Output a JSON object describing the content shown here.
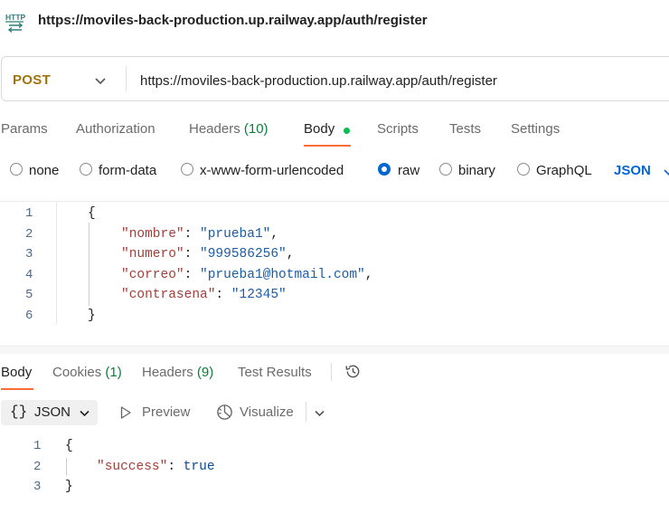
{
  "title_bar": {
    "icon_text": "HTTP",
    "url": "https://moviles-back-production.up.railway.app/auth/register"
  },
  "request": {
    "method": "POST",
    "url": "https://moviles-back-production.up.railway.app/auth/register"
  },
  "request_tabs": {
    "params": "Params",
    "authorization": "Authorization",
    "headers": "Headers",
    "headers_count": "(10)",
    "body": "Body",
    "scripts": "Scripts",
    "tests": "Tests",
    "settings": "Settings"
  },
  "body_types": {
    "none": "none",
    "form_data": "form-data",
    "urlencoded": "x-www-form-urlencoded",
    "raw": "raw",
    "binary": "binary",
    "graphql": "GraphQL",
    "selected": "raw",
    "language": "JSON"
  },
  "request_body": {
    "line_numbers": [
      "1",
      "2",
      "3",
      "4",
      "5",
      "6"
    ],
    "open_brace": "{",
    "close_brace": "}",
    "fields": [
      {
        "key": "\"nombre\"",
        "value": "\"prueba1\"",
        "trail": ","
      },
      {
        "key": "\"numero\"",
        "value": "\"999586256\"",
        "trail": ","
      },
      {
        "key": "\"correo\"",
        "value": "\"prueba1@hotmail.com\"",
        "trail": ","
      },
      {
        "key": "\"contrasena\"",
        "value": "\"12345\"",
        "trail": ""
      }
    ],
    "colon": ": "
  },
  "response_tabs": {
    "body": "Body",
    "cookies": "Cookies",
    "cookies_count": "(1)",
    "headers": "Headers",
    "headers_count": "(9)",
    "test_results": "Test Results"
  },
  "response_toolbar": {
    "braces": "{}",
    "format": "JSON",
    "preview": "Preview",
    "visualize": "Visualize"
  },
  "response_body": {
    "line_numbers": [
      "1",
      "2",
      "3"
    ],
    "open_brace": "{",
    "close_brace": "}",
    "key": "\"success\"",
    "colon": ": ",
    "value": "true"
  },
  "colors": {
    "accent_orange": "#ff6c37",
    "method_post": "#a0740a",
    "link_blue": "#0265d2",
    "success_green": "#0cbb52"
  },
  "icons": [
    "http-file-icon",
    "chevron-down-icon",
    "history-icon",
    "play-icon",
    "visualize-icon"
  ]
}
